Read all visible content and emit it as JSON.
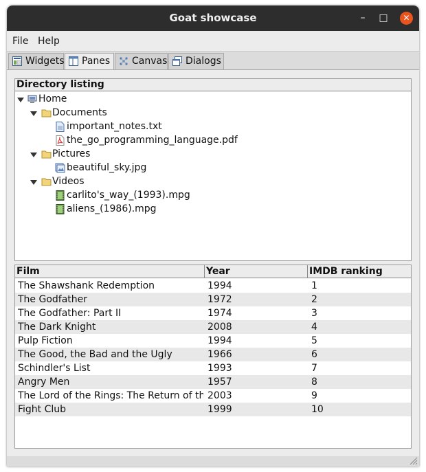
{
  "window": {
    "title": "Goat showcase",
    "controls": {
      "minimize": "–",
      "maximize": "□",
      "close": "✕"
    },
    "close_color": "#e9541f"
  },
  "menubar": {
    "items": [
      "File",
      "Help"
    ]
  },
  "tabs": [
    {
      "label": "Widgets",
      "icon": "widgets-icon",
      "active": false
    },
    {
      "label": "Panes",
      "icon": "panes-icon",
      "active": true
    },
    {
      "label": "Canvas",
      "icon": "canvas-icon",
      "active": false
    },
    {
      "label": "Dialogs",
      "icon": "dialogs-icon",
      "active": false
    }
  ],
  "tree": {
    "header": "Directory listing",
    "items": [
      {
        "label": "Home",
        "icon": "computer-icon",
        "expandable": true
      },
      {
        "label": "Documents",
        "icon": "folder-icon",
        "expandable": true
      },
      {
        "label": "important_notes.txt",
        "icon": "text-file-icon",
        "expandable": false
      },
      {
        "label": "the_go_programming_language.pdf",
        "icon": "pdf-file-icon",
        "expandable": false
      },
      {
        "label": "Pictures",
        "icon": "folder-icon",
        "expandable": true
      },
      {
        "label": "beautiful_sky.jpg",
        "icon": "image-file-icon",
        "expandable": false
      },
      {
        "label": "Videos",
        "icon": "folder-icon",
        "expandable": true
      },
      {
        "label": "carlito's_way_(1993).mpg",
        "icon": "video-file-icon",
        "expandable": false
      },
      {
        "label": "aliens_(1986).mpg",
        "icon": "video-file-icon",
        "expandable": false
      }
    ]
  },
  "table": {
    "columns": [
      "Film",
      "Year",
      "IMDB ranking"
    ],
    "rows": [
      [
        "The Shawshank Redemption",
        "1994",
        "1"
      ],
      [
        "The Godfather",
        "1972",
        "2"
      ],
      [
        "The Godfather: Part II",
        "1974",
        "3"
      ],
      [
        "The Dark Knight",
        "2008",
        "4"
      ],
      [
        "Pulp Fiction",
        "1994",
        "5"
      ],
      [
        "The Good, the Bad and the Ugly",
        "1966",
        "6"
      ],
      [
        "Schindler's List",
        "1993",
        "7"
      ],
      [
        "Angry Men",
        "1957",
        "8"
      ],
      [
        "The Lord of the Rings: The Return of the King",
        "2003",
        "9"
      ],
      [
        "Fight Club",
        "1999",
        "10"
      ]
    ]
  }
}
